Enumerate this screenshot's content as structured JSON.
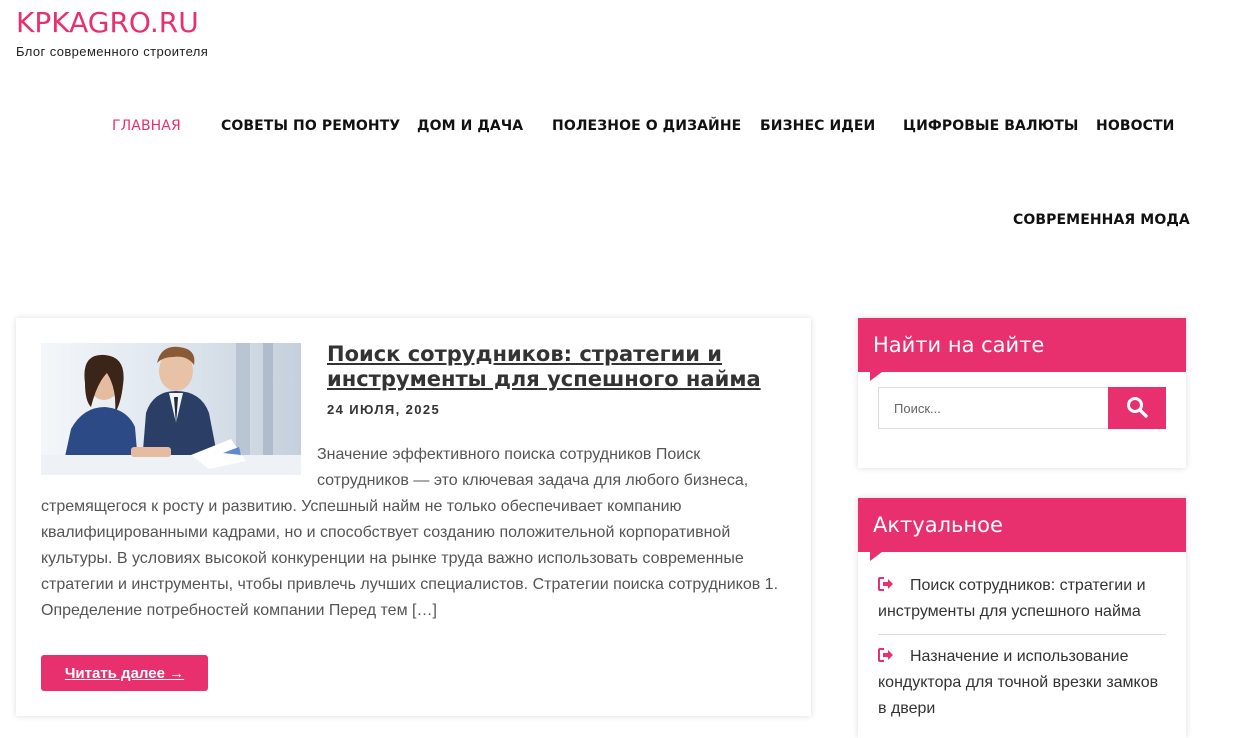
{
  "site": {
    "title": "KPKAGRO.RU",
    "tagline": "Блог современного строителя"
  },
  "nav": {
    "items": [
      {
        "label": "ГЛАВНАЯ",
        "active": true
      },
      {
        "label": "СОВЕТЫ ПО РЕМОНТУ"
      },
      {
        "label": "ДОМ И ДАЧА"
      },
      {
        "label": "ПОЛЕЗНОЕ О ДИЗАЙНЕ"
      },
      {
        "label": "БИЗНЕС ИДЕИ"
      },
      {
        "label": "ЦИФРОВЫЕ ВАЛЮТЫ"
      },
      {
        "label": "НОВОСТИ"
      },
      {
        "label": "СОВРЕМЕННАЯ МОДА"
      }
    ]
  },
  "post": {
    "title": "Поиск сотрудников: стратегии и инструменты для успешного найма",
    "date": "24 ИЮЛЯ, 2025",
    "excerpt": "Значение эффективного поиска сотрудников Поиск сотрудников — это ключевая задача для любого бизнеса, стремящегося к росту и развитию. Успешный найм не только обеспечивает компанию квалифицированными кадрами, но и способствует созданию положительной корпоративной культуры. В условиях высокой конкуренции на рынке труда важно использовать современные стратегии и инструменты, чтобы привлечь лучших специалистов. Стратегии поиска сотрудников 1. Определение потребностей компании Перед тем […]",
    "read_more": "Читать далее →"
  },
  "sidebar": {
    "search": {
      "title": "Найти на сайте",
      "placeholder": "Поиск..."
    },
    "recent": {
      "title": "Актуальное",
      "items": [
        "Поиск сотрудников: стратегии и инструменты для успешного найма",
        "Назначение и использование кондуктора для точной врезки замков в двери"
      ]
    }
  },
  "colors": {
    "accent": "#e8306f",
    "text": "#333333",
    "muted": "#555555"
  }
}
